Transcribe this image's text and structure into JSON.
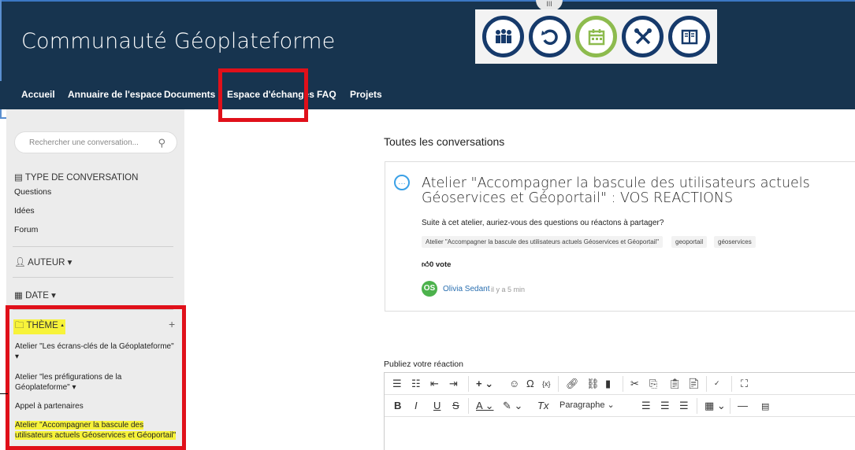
{
  "header": {
    "title": "Communauté Géoplateforme",
    "drag_label": "III"
  },
  "icon_strip": {
    "icons": [
      "community-icon",
      "refresh-icon",
      "calendar-icon",
      "tools-icon",
      "book-icon"
    ]
  },
  "nav": {
    "items": [
      "Accueil",
      "Annuaire de l'espace",
      "Documents",
      "Espace d'échanges",
      "FAQ",
      "Projets"
    ]
  },
  "sidebar": {
    "search_placeholder": "Rechercher une conversation...",
    "type_title": "TYPE DE CONVERSATION",
    "type_items": [
      "Questions",
      "Idées",
      "Forum"
    ],
    "author_title": "AUTEUR",
    "date_title": "DATE",
    "theme_title": "THÈME",
    "theme_add": "+",
    "theme_items": [
      "Atelier \"Les écrans-clés de la Géoplateforme\"",
      "Atelier \"les préfigurations de la Géoplateforme\"",
      "Appel à partenaires",
      "Atelier \"Accompagner la bascule des utilisateurs actuels Géoservices et Géoportail\""
    ]
  },
  "main": {
    "title": "Toutes les conversations",
    "conversation": {
      "heading": "Atelier \"Accompagner la bascule des utilisateurs actuels Géoservices et Géoportail\" : VOS REACTIONS",
      "description": "Suite à cet atelier, auriez-vous des questions ou réactons à partager?",
      "tags": [
        "Atelier \"Accompagner la bascule des utilisateurs actuels Géoservices et Géoportail\"",
        "geoportail",
        "géoservices"
      ],
      "votes": "0 vote",
      "avatar_initials": "OS",
      "author": "Olivia Sedant",
      "time": "il y a 5 min"
    },
    "publish_label": "Publiez votre réaction",
    "editor": {
      "format_label": "Paragraphe"
    }
  },
  "colors": {
    "header_bg": "#17344f",
    "highlight": "#e0101a",
    "marker": "#f7f33a",
    "accent_green": "#8dbb4e"
  }
}
